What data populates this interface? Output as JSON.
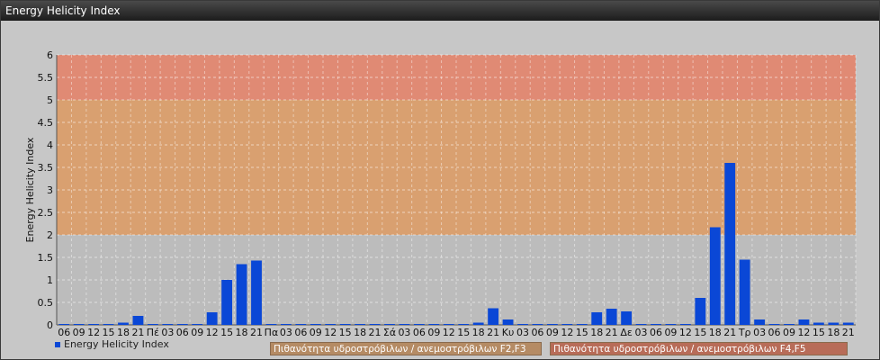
{
  "window": {
    "title": "Energy Helicity Index"
  },
  "chart_data": {
    "type": "bar",
    "ylabel": "Energy Helicity Index",
    "ylim": [
      0,
      6
    ],
    "yticks": [
      "0",
      "0.5",
      "1",
      "1.5",
      "2",
      "2.5",
      "3",
      "3.5",
      "4",
      "4.5",
      "5",
      "5.5",
      "6"
    ],
    "grid": true,
    "legend_position": "bottom-left",
    "series": [
      {
        "name": "Energy Helicity Index",
        "color": "#0a47d6",
        "values": [
          0.02,
          0.02,
          0.02,
          0.02,
          0.05,
          0.2,
          0.02,
          0.02,
          0.02,
          0.02,
          0.28,
          1.0,
          1.35,
          1.43,
          0.02,
          0.02,
          0.02,
          0.02,
          0.02,
          0.02,
          0.02,
          0.02,
          0.02,
          0.02,
          0.02,
          0.02,
          0.02,
          0.02,
          0.05,
          0.37,
          0.12,
          0.02,
          0.02,
          0.02,
          0.02,
          0.02,
          0.28,
          0.36,
          0.3,
          0.02,
          0.02,
          0.02,
          0.02,
          0.6,
          2.17,
          3.6,
          1.45,
          0.12,
          0.02,
          0.02,
          0.12,
          0.05,
          0.05,
          0.05
        ]
      }
    ],
    "categories": [
      "06",
      "09",
      "12",
      "15",
      "18",
      "21",
      "Πέ",
      "03",
      "06",
      "09",
      "12",
      "15",
      "18",
      "21",
      "Πα",
      "03",
      "06",
      "09",
      "12",
      "15",
      "18",
      "21",
      "Σά",
      "03",
      "06",
      "09",
      "12",
      "15",
      "18",
      "21",
      "Κυ",
      "03",
      "06",
      "09",
      "12",
      "15",
      "18",
      "21",
      "Δε",
      "03",
      "06",
      "09",
      "12",
      "15",
      "18",
      "21",
      "Τρ",
      "03",
      "06",
      "09",
      "12",
      "15",
      "18",
      "21"
    ],
    "bands": [
      {
        "from": 0,
        "to": 2,
        "color": "#bcbcbc"
      },
      {
        "from": 2,
        "to": 5,
        "color": "#d9a070"
      },
      {
        "from": 5,
        "to": 6,
        "color": "#e08a74"
      }
    ],
    "band_labels": [
      "Πιθανότητα υδροστρόβιλων / ανεμοστρόβιλων F2,F3",
      "Πιθανότητα υδροστρόβιλων / ανεμοστρόβιλων F4,F5"
    ]
  }
}
